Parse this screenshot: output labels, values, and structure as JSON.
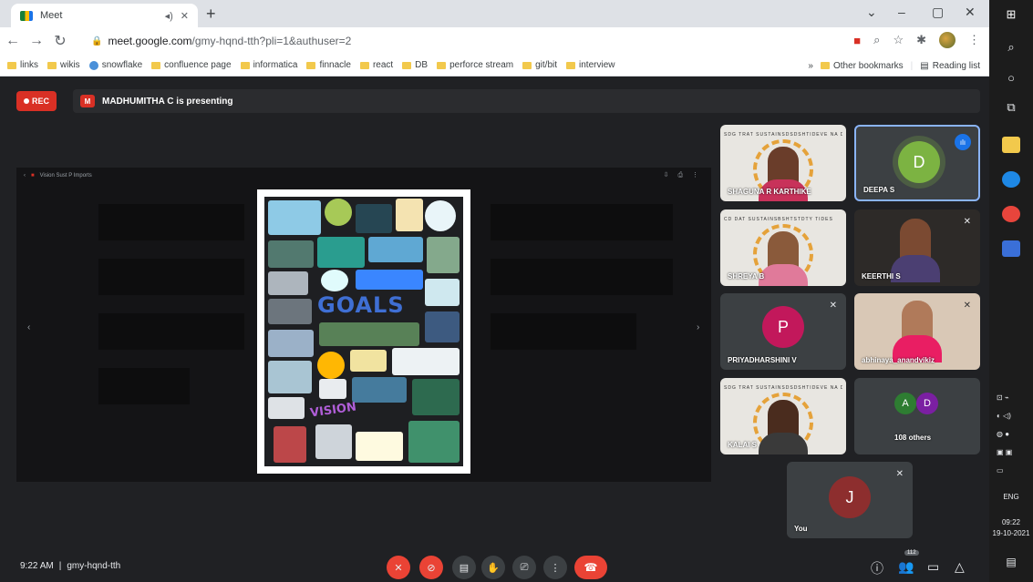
{
  "browser": {
    "tab_title": "Meet",
    "url_host": "meet.google.com",
    "url_path": "/gmy-hqnd-tth?pli=1&authuser=2",
    "bookmarks": [
      "links",
      "wikis",
      "snowflake",
      "confluence page",
      "informatica",
      "finnacle",
      "react",
      "DB",
      "perforce stream",
      "git/bit",
      "interview"
    ],
    "other_bookmarks": "Other bookmarks",
    "reading_list": "Reading list",
    "more": "»"
  },
  "meet": {
    "rec_label": "REC",
    "presenter_initial": "M",
    "presenting_text": "MADHUMITHA C is presenting",
    "share_header": "Vision Sust P Imports",
    "poster_goals": "GOALS",
    "poster_vision": "VISION",
    "meeting_time": "9:22 AM",
    "meeting_separator": "|",
    "meeting_code": "gmy-hqnd-tth",
    "participants_count": "112",
    "tiles": [
      {
        "name": "SHAGUNA R KARTHIKE",
        "caption": "SDG TRAT SUSTAINSDSDSHTIDEVE NA DE"
      },
      {
        "name": "DEEPA S",
        "initial": "D",
        "color": "#7cb342"
      },
      {
        "name": "SHREYA B",
        "caption": "CD DAT SUSTAINSBSHTSTDTY TIDES"
      },
      {
        "name": "KEERTHI S"
      },
      {
        "name": "PRIYADHARSHINI V",
        "initial": "P",
        "color": "#c2185b"
      },
      {
        "name": "abhinaya_anandvikiz"
      },
      {
        "name": "KALAI S",
        "caption": "SDG TRAT SUSTAINSDSDSHTIDEVE NA DE"
      },
      {
        "name": "108 others",
        "a_initial": "A",
        "d_initial": "D"
      },
      {
        "name": "You",
        "initial": "J",
        "color": "#8d2e2e"
      }
    ]
  },
  "taskbar": {
    "lang": "ENG",
    "time": "09:22",
    "date": "19-10-2021"
  }
}
